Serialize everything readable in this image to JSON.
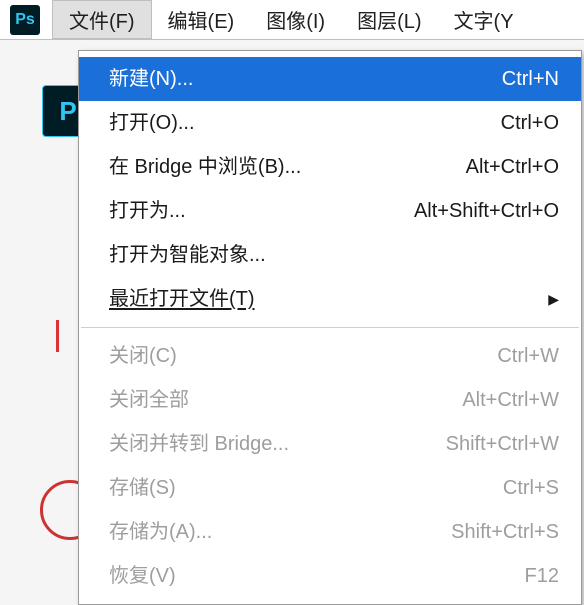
{
  "app": {
    "logo_text": "Ps",
    "doc_logo_text": "P"
  },
  "menubar": {
    "items": [
      {
        "label": "文件(F)",
        "open": true
      },
      {
        "label": "编辑(E)",
        "open": false
      },
      {
        "label": "图像(I)",
        "open": false
      },
      {
        "label": "图层(L)",
        "open": false
      },
      {
        "label": "文字(Y",
        "open": false
      }
    ]
  },
  "dropdown": {
    "groups": [
      [
        {
          "label": "新建(N)...",
          "shortcut": "Ctrl+N",
          "highlighted": true
        },
        {
          "label": "打开(O)...",
          "shortcut": "Ctrl+O"
        },
        {
          "label": "在 Bridge 中浏览(B)...",
          "shortcut": "Alt+Ctrl+O"
        },
        {
          "label": "打开为...",
          "shortcut": "Alt+Shift+Ctrl+O"
        },
        {
          "label": "打开为智能对象..."
        },
        {
          "label": "最近打开文件(T)",
          "submenu": true,
          "underlined": true
        }
      ],
      [
        {
          "label": "关闭(C)",
          "shortcut": "Ctrl+W",
          "disabled": true
        },
        {
          "label": "关闭全部",
          "shortcut": "Alt+Ctrl+W",
          "disabled": true
        },
        {
          "label": "关闭并转到 Bridge...",
          "shortcut": "Shift+Ctrl+W",
          "disabled": true
        },
        {
          "label": "存储(S)",
          "shortcut": "Ctrl+S",
          "disabled": true
        },
        {
          "label": "存储为(A)...",
          "shortcut": "Shift+Ctrl+S",
          "disabled": true
        },
        {
          "label": "恢复(V)",
          "shortcut": "F12",
          "disabled": true
        }
      ]
    ]
  }
}
